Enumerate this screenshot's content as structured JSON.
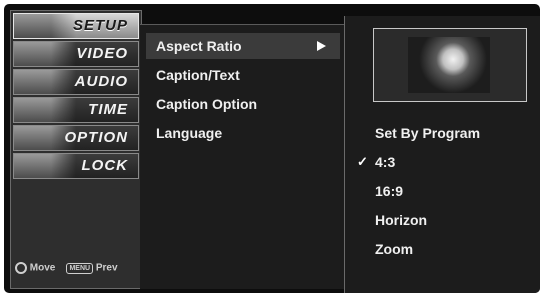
{
  "tabs": [
    {
      "label": "SETUP",
      "icon": "setup-icon",
      "active": true
    },
    {
      "label": "VIDEO",
      "icon": "video-icon",
      "active": false
    },
    {
      "label": "AUDIO",
      "icon": "audio-icon",
      "active": false
    },
    {
      "label": "TIME",
      "icon": "clock-icon",
      "active": false
    },
    {
      "label": "OPTION",
      "icon": "option-icon",
      "active": false
    },
    {
      "label": "LOCK",
      "icon": "lock-icon",
      "active": false
    }
  ],
  "footer": {
    "move": "Move",
    "menu_key": "MENU",
    "prev": "Prev"
  },
  "submenu": {
    "items": [
      {
        "label": "Aspect Ratio",
        "selected": true
      },
      {
        "label": "Caption/Text",
        "selected": false
      },
      {
        "label": "Caption Option",
        "selected": false
      },
      {
        "label": "Language",
        "selected": false
      }
    ]
  },
  "options": {
    "items": [
      {
        "label": "Set By Program",
        "checked": false
      },
      {
        "label": "4:3",
        "checked": true
      },
      {
        "label": "16:9",
        "checked": false
      },
      {
        "label": "Horizon",
        "checked": false
      },
      {
        "label": "Zoom",
        "checked": false
      }
    ],
    "check_mark": "✓"
  },
  "colors": {
    "background": "#0d0d0d",
    "highlight": "#3b3b3b",
    "text": "#f0f0f0"
  }
}
